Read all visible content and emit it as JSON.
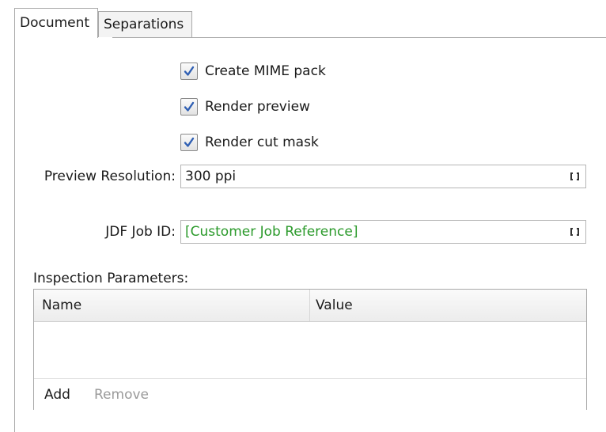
{
  "tabs": [
    {
      "label": "Document",
      "active": true
    },
    {
      "label": "Separations",
      "active": false
    }
  ],
  "checkboxes": [
    {
      "label": "Create MIME pack",
      "checked": true
    },
    {
      "label": "Render preview",
      "checked": true
    },
    {
      "label": "Render cut mask",
      "checked": true
    }
  ],
  "preview_resolution": {
    "label": "Preview Resolution:",
    "value": "300 ppi",
    "icon": "variable-brackets-icon"
  },
  "jdf_job_id": {
    "label": "JDF Job ID:",
    "value": "[Customer Job Reference]",
    "value_color": "#2b9a2b",
    "icon": "variable-brackets-icon"
  },
  "inspection": {
    "label": "Inspection Parameters:",
    "columns": [
      "Name",
      "Value"
    ],
    "rows": [],
    "add_label": "Add",
    "remove_label": "Remove"
  },
  "colors": {
    "check_mark": "#2f5fb3",
    "border": "#a9a9a9",
    "disabled_text": "#9a9a9a"
  }
}
